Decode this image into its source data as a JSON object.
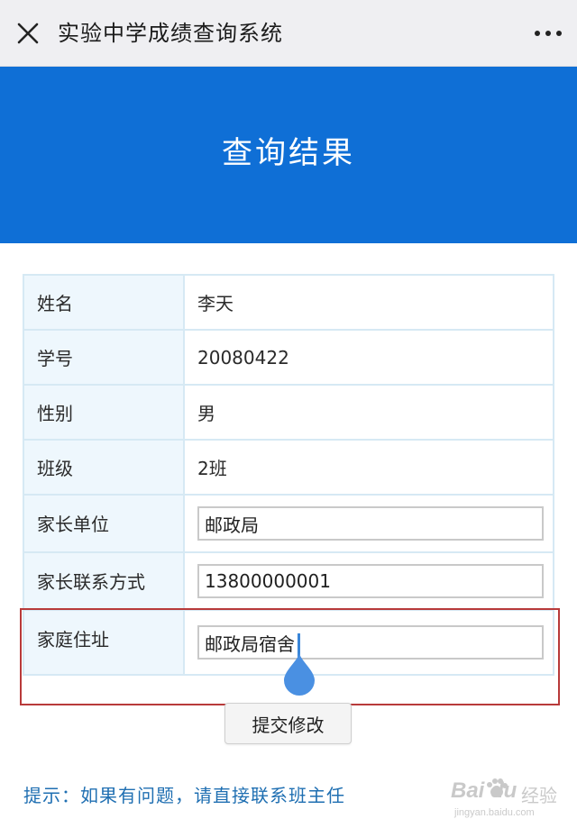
{
  "titlebar": {
    "title": "实验中学成绩查询系统",
    "close_icon": "close-icon",
    "more_icon": "more-dots-icon"
  },
  "banner": {
    "heading": "查询结果",
    "color": "#0f6fd6"
  },
  "rows": [
    {
      "label": "姓名",
      "value": "李天"
    },
    {
      "label": "学号",
      "value": "20080422"
    },
    {
      "label": "性别",
      "value": "男"
    },
    {
      "label": "班级",
      "value": "2班"
    },
    {
      "label": "家长单位",
      "value": "邮政局"
    },
    {
      "label": "家长联系方式",
      "value": "13800000001"
    },
    {
      "label": "家庭住址",
      "value": "邮政局宿舍"
    }
  ],
  "submit_label": "提交修改",
  "tip": "提示：如果有问题，请直接联系班主任",
  "watermark": {
    "logo_text": "Bai du",
    "logo_cn": "经验",
    "url": "jingyan.baidu.com"
  },
  "colors": {
    "highlight_border": "#b83a3a",
    "tip_text": "#1f6fb2",
    "cell_border": "#d6e9f4"
  }
}
